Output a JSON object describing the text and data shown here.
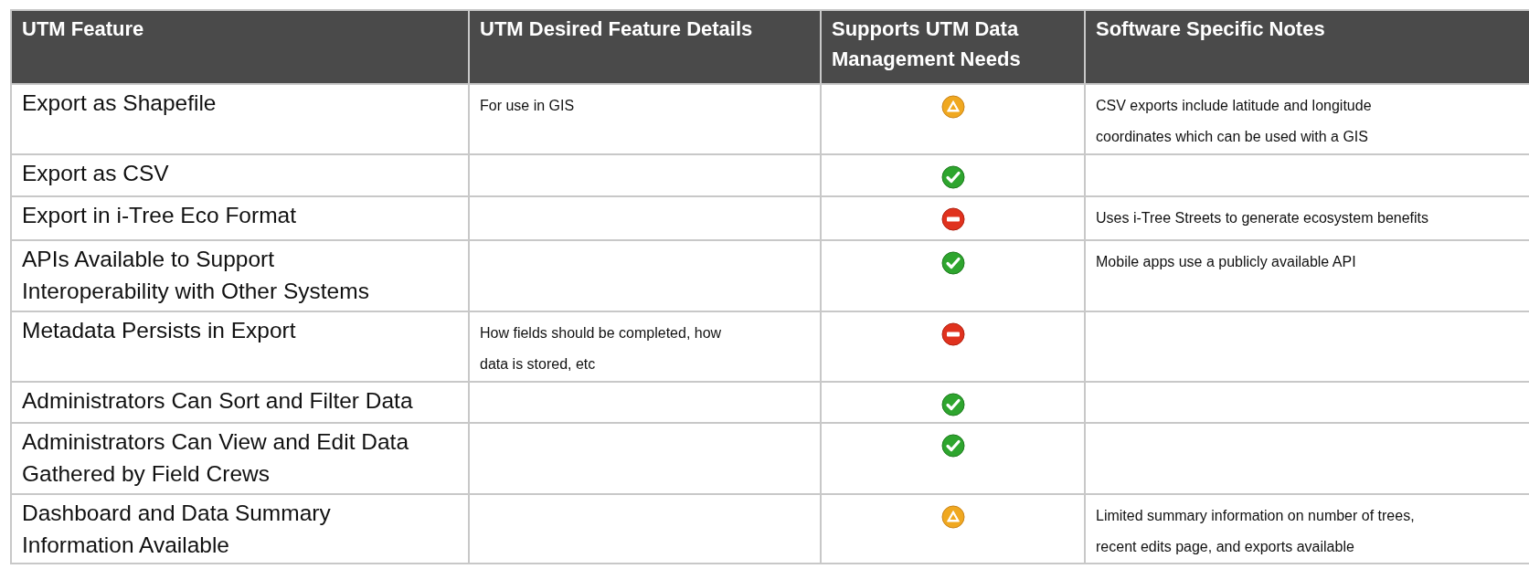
{
  "table": {
    "columns": [
      "UTM Feature",
      "UTM Desired Feature Details",
      "Supports UTM Data Management Needs",
      "Software Specific Notes"
    ],
    "rows": [
      {
        "feature": "Export as Shapefile",
        "details": "For use in GIS",
        "kind": "partial",
        "notes": "CSV exports include latitude and longitude coordinates which can be used with a GIS"
      },
      {
        "feature": "Export as CSV",
        "kind": "yes"
      },
      {
        "feature": "Export in i-Tree Eco Format",
        "kind": "no",
        "notes": "Uses i-Tree Streets to generate ecosystem benefits"
      },
      {
        "feature": "APIs Available to Support Interoperability with Other Systems",
        "kind": "yes",
        "notes": "Mobile apps use a publicly available API"
      },
      {
        "feature": "Metadata Persists in Export",
        "details": "How fields should be completed, how data is stored, etc",
        "kind": "no"
      },
      {
        "feature": "Administrators Can Sort and Filter Data",
        "kind": "yes"
      },
      {
        "feature": "Administrators Can View and Edit Data Gathered by Field Crews",
        "kind": "yes"
      },
      {
        "feature": "Dashboard and Data Summary Information Available",
        "kind": "partial",
        "notes": "Limited summary information on number of trees, recent edits page, and exports available"
      }
    ]
  }
}
